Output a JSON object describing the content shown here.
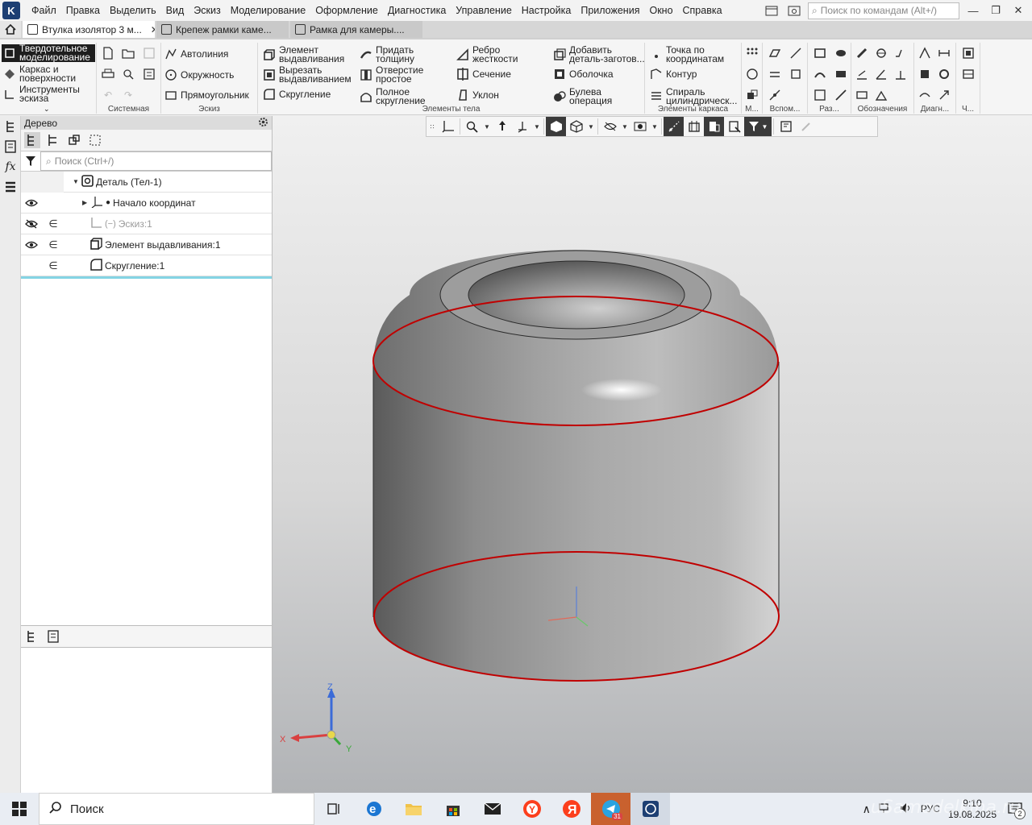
{
  "menu": {
    "items": [
      "Файл",
      "Правка",
      "Выделить",
      "Вид",
      "Эскиз",
      "Моделирование",
      "Оформление",
      "Диагностика",
      "Управление",
      "Настройка",
      "Приложения",
      "Окно",
      "Справка"
    ],
    "command_search_placeholder": "Поиск по командам (Alt+/)"
  },
  "tabs": [
    {
      "label": "Втулка изолятор 3 м...",
      "active": true
    },
    {
      "label": "Крепеж рамки каме...",
      "active": false
    },
    {
      "label": "Рамка для камеры....",
      "active": false
    }
  ],
  "ribbon": {
    "modes": [
      "Твердотельное моделирование",
      "Каркас и поверхности",
      "Инструменты эскиза"
    ],
    "sketch_buttons": [
      "Автолиния",
      "Окружность",
      "Прямоугольник"
    ],
    "body_buttons": [
      "Элемент выдавливания",
      "Вырезать выдавливанием",
      "Скругление",
      "Придать толщину",
      "Отверстие простое",
      "Полное скругление",
      "Ребро жесткости",
      "Сечение",
      "Уклон",
      "Добавить деталь-заготов...",
      "Оболочка",
      "Булева операция"
    ],
    "frame_buttons": [
      "Точка по координатам",
      "Контур",
      "Спираль цилиндрическ..."
    ],
    "group_labels": [
      "Системная",
      "Эскиз",
      "Элементы тела",
      "Элементы каркаса",
      "М...",
      "Вспом...",
      "Раз...",
      "Обозначения",
      "Диагн...",
      "Ч..."
    ]
  },
  "tree": {
    "title": "Дерево",
    "search_placeholder": "Поиск (Ctrl+/)",
    "nodes": [
      {
        "label": "Деталь (Тел-1)",
        "level": 0,
        "disabled": false
      },
      {
        "label": "Начало координат",
        "level": 1,
        "disabled": false
      },
      {
        "label": "Эскиз:1",
        "level": 1,
        "disabled": true
      },
      {
        "label": "Элемент выдавливания:1",
        "level": 1,
        "disabled": false
      },
      {
        "label": "Скругление:1",
        "level": 1,
        "disabled": false
      }
    ]
  },
  "axes": {
    "z": "Z",
    "x": "X",
    "y": "Y"
  },
  "taskbar": {
    "search_label": "Поиск",
    "apps": [
      "task-view",
      "edge",
      "explorer",
      "store",
      "mail",
      "yandex-browser",
      "yandex",
      "telegram",
      "kompas-3d"
    ],
    "telegram_badge": "31",
    "language": "РУС",
    "time": "9:10",
    "date": "19.08.2025",
    "notifications": "2",
    "watermark": "uSamodelkina.ru"
  },
  "colors": {
    "accent": "#1d3f73",
    "selection_edge": "#c00000",
    "tree_end_line": "#84d4e4"
  }
}
